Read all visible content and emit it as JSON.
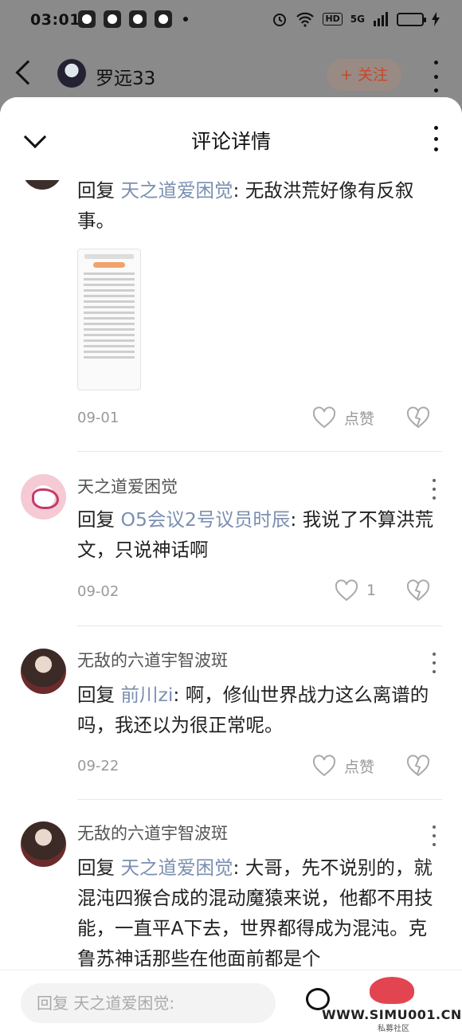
{
  "status_bar": {
    "time": "03:01",
    "network": "5G",
    "hd": "HD"
  },
  "header": {
    "profile_name": "罗远33",
    "follow_label": "+ 关注"
  },
  "sheet": {
    "title": "评论详情"
  },
  "comments": [
    {
      "reply_prefix": "回复 ",
      "mention": "天之道爱困觉",
      "text": ": 无敌洪荒好像有反叙事。",
      "date": "09-01",
      "like_label": "点赞",
      "has_image": true
    },
    {
      "name": "天之道爱困觉",
      "reply_prefix": "回复 ",
      "mention": "O5会议2号议员时辰",
      "text": ": 我说了不算洪荒文，只说神话啊",
      "date": "09-02",
      "like_label": "1"
    },
    {
      "name": "无敌的六道宇智波斑",
      "reply_prefix": "回复 ",
      "mention": "前川zi",
      "text": ": 啊，修仙世界战力这么离谱的吗，我还以为很正常呢。",
      "date": "09-22",
      "like_label": "点赞"
    },
    {
      "name": "无敌的六道宇智波斑",
      "reply_prefix": "回复 ",
      "mention": "天之道爱困觉",
      "text": ": 大哥，先不说别的，就混沌四猴合成的混动魔猿来说，他都不用技能，一直平A下去，世界都得成为混沌。克鲁苏神话那些在他面前都是个"
    }
  ],
  "reply_bar": {
    "placeholder": "回复 天之道爱困觉:"
  },
  "watermark": {
    "text": "WWW.SIMU001.CN",
    "sub": "私募社区"
  }
}
